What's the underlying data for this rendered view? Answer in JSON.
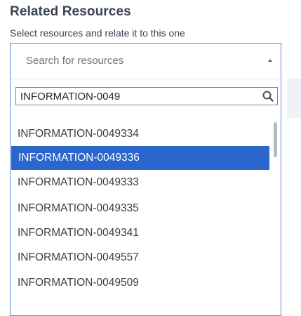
{
  "header": {
    "title": "Related Resources",
    "subtitle": "Select resources and relate it to this one"
  },
  "dropdown": {
    "trigger_placeholder": "Search for resources",
    "search_value": "INFORMATION-0049",
    "selected_index": 1,
    "options": [
      "INFORMATION-0049334",
      "INFORMATION-0049336",
      "INFORMATION-0049333",
      "INFORMATION-0049335",
      "INFORMATION-0049341",
      "INFORMATION-0049557",
      "INFORMATION-0049509"
    ]
  },
  "colors": {
    "accent": "#2a66cc",
    "border": "#5b8fd6",
    "text": "#3a4351"
  },
  "icons": {
    "search": "search-icon",
    "caret": "caret-up-icon"
  }
}
